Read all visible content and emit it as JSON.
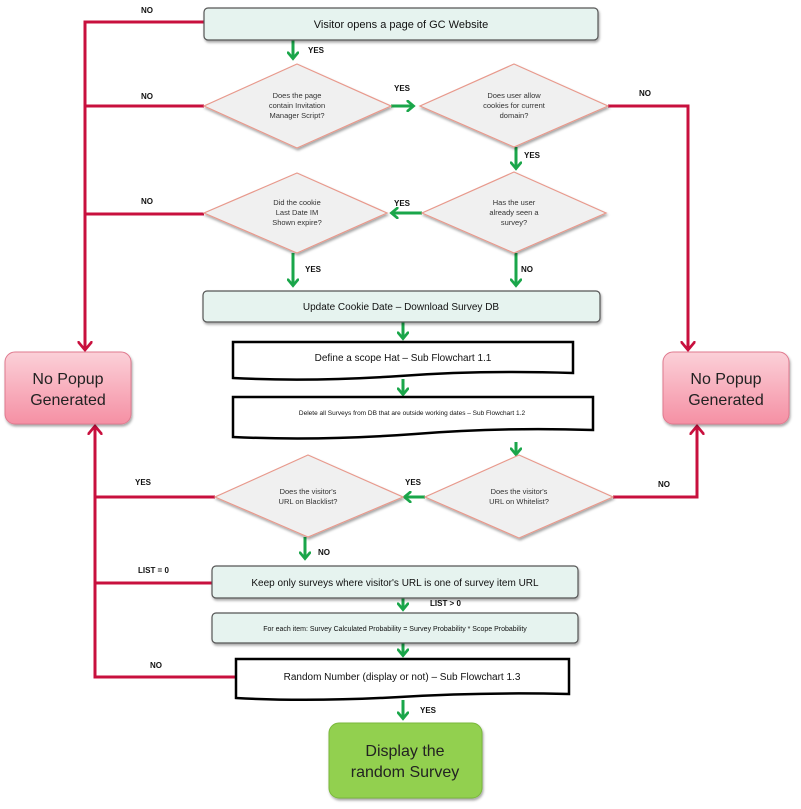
{
  "diagram": {
    "colors": {
      "yes_arrow": "#1aa64a",
      "no_line": "#c8103e",
      "process_fill": "#e6f3ef",
      "decision_fill": "#f0f0f0",
      "decision_stroke": "#e8998c",
      "no_popup_fill": "#f7aab8",
      "display_fill": "#92d050"
    },
    "nodes": {
      "start": "Visitor opens a page of GC Website",
      "q_script": [
        "Does the page",
        "contain Invitation",
        "Manager Script?"
      ],
      "q_cookies": [
        "Does user allow",
        "cookies for current",
        "domain?"
      ],
      "q_cookie_expire": [
        "Did the cookie",
        "Last Date IM",
        "Shown expire?"
      ],
      "q_seen": [
        "Has the user",
        "already seen a",
        "survey?"
      ],
      "update_cookie": "Update Cookie Date – Download Survey DB",
      "define_scope": "Define a scope Hat – Sub Flowchart 1.1",
      "delete_surveys": "Delete all Surveys from DB that are outside working dates – Sub Flowchart 1.2",
      "q_blacklist": [
        "Does the visitor's",
        "URL on Blacklist?"
      ],
      "q_whitelist": [
        "Does the visitor's",
        "URL on Whitelist?"
      ],
      "keep_surveys": "Keep only surveys where visitor's URL is one of survey item URL",
      "calc_probability": "For each item: Survey Calculated Probability = Survey Probability * Scope Probability",
      "random_number": "Random Number (display or not) – Sub Flowchart 1.3",
      "no_popup_left": [
        "No Popup",
        "Generated"
      ],
      "no_popup_right": [
        "No Popup",
        "Generated"
      ],
      "display_survey": [
        "Display the",
        "random Survey"
      ]
    },
    "edge_labels": {
      "start_no": "NO",
      "start_yes": "YES",
      "script_no": "NO",
      "script_yes": "YES",
      "cookies_no": "NO",
      "cookies_yes": "YES",
      "expire_no": "NO",
      "seen_yes": "YES",
      "expire_yes": "YES",
      "seen_no": "NO",
      "blacklist_yes": "YES",
      "whitelist_yes": "YES",
      "whitelist_no": "NO",
      "blacklist_no": "NO",
      "list_zero": "LIST = 0",
      "list_gt_zero": "LIST > 0",
      "random_no": "NO",
      "random_yes": "YES"
    }
  }
}
